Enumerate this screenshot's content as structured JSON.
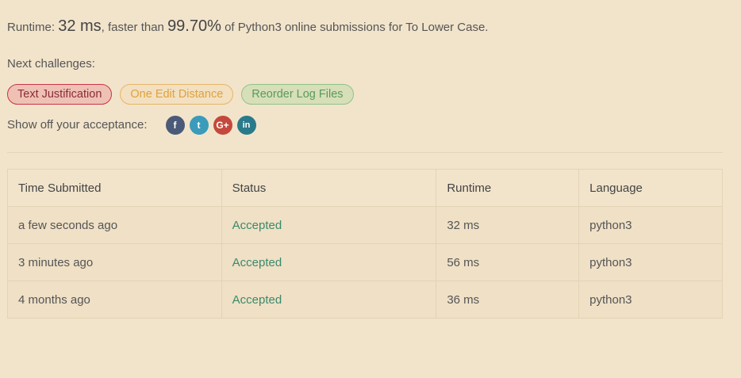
{
  "result": {
    "runtime_prefix": "Runtime: ",
    "runtime_value": "32 ms",
    "faster_text": ", faster than ",
    "percent": "99.70%",
    "suffix": " of Python3 online submissions for To Lower Case."
  },
  "next_challenges": {
    "label": "Next challenges:",
    "items": [
      {
        "label": "Text Justification",
        "difficulty": "hard"
      },
      {
        "label": "One Edit Distance",
        "difficulty": "medium"
      },
      {
        "label": "Reorder Log Files",
        "difficulty": "easy"
      }
    ]
  },
  "share": {
    "label": "Show off your acceptance:",
    "icons": [
      {
        "name": "facebook-icon",
        "glyph": "f"
      },
      {
        "name": "twitter-icon",
        "glyph": "t"
      },
      {
        "name": "google-plus-icon",
        "glyph": "G+"
      },
      {
        "name": "linkedin-icon",
        "glyph": "in"
      }
    ]
  },
  "submissions": {
    "headers": [
      "Time Submitted",
      "Status",
      "Runtime",
      "Language"
    ],
    "rows": [
      {
        "time": "a few seconds ago",
        "status": "Accepted",
        "runtime": "32 ms",
        "language": "python3"
      },
      {
        "time": "3 minutes ago",
        "status": "Accepted",
        "runtime": "56 ms",
        "language": "python3"
      },
      {
        "time": "4 months ago",
        "status": "Accepted",
        "runtime": "36 ms",
        "language": "python3"
      }
    ]
  },
  "colors": {
    "background": "#f2e4cb",
    "accepted": "#3a8a6a",
    "hard": "#c9334a",
    "medium": "#e8b467",
    "easy": "#90c289"
  }
}
